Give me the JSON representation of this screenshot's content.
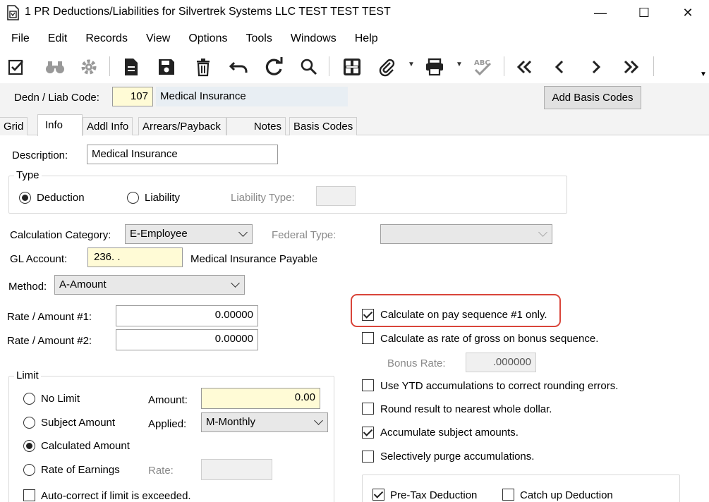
{
  "window": {
    "title": "1 PR Deductions/Liabilities for Silvertrek Systems LLC TEST TEST TEST",
    "icon": "app-document-icon",
    "controls": {
      "minimize": "—",
      "maximize": "☐",
      "close": "✕"
    }
  },
  "menu": [
    "File",
    "Edit",
    "Records",
    "View",
    "Options",
    "Tools",
    "Windows",
    "Help"
  ],
  "toolbar": {
    "icons": [
      "edit-check-icon",
      "binoculars-icon",
      "gear-icon",
      "new-document-icon",
      "save-icon",
      "trash-icon",
      "undo-icon",
      "refresh-icon",
      "search-icon",
      "grid-icon",
      "paperclip-icon",
      "print-icon",
      "spellcheck-icon",
      "first-record-icon",
      "previous-record-icon",
      "next-record-icon",
      "last-record-icon"
    ]
  },
  "header": {
    "code_label": "Dedn / Liab Code:",
    "code_value": "107",
    "code_description": "Medical Insurance",
    "add_basis_button": "Add Basis Codes"
  },
  "tabs": [
    {
      "label": "Grid",
      "active": false
    },
    {
      "label": "Info",
      "active": true
    },
    {
      "label": "Addl Info",
      "active": false
    },
    {
      "label": "Arrears/Payback",
      "active": false
    },
    {
      "label": "Notes",
      "active": false
    },
    {
      "label": "Basis Codes",
      "active": false
    }
  ],
  "info": {
    "description_label": "Description:",
    "description_value": "Medical Insurance",
    "type": {
      "title": "Type",
      "deduction": "Deduction",
      "liability": "Liability",
      "selected": "Deduction",
      "liability_type_label": "Liability Type:",
      "liability_type_value": ""
    },
    "calc_category_label": "Calculation Category:",
    "calc_category_value": "E-Employee",
    "federal_type_label": "Federal Type:",
    "federal_type_value": "",
    "gl_account_label": "GL Account:",
    "gl_account_value": "236.  .",
    "gl_account_description": "Medical Insurance Payable",
    "method_label": "Method:",
    "method_value": "A-Amount",
    "rate1_label": "Rate / Amount #1:",
    "rate1_value": "0.00000",
    "rate2_label": "Rate / Amount #2:",
    "rate2_value": "0.00000",
    "limit": {
      "title": "Limit",
      "no_limit": "No Limit",
      "subject_amount": "Subject Amount",
      "calculated_amount": "Calculated Amount",
      "rate_of_earnings": "Rate of Earnings",
      "selected": "Calculated Amount",
      "amount_label": "Amount:",
      "amount_value": "0.00",
      "applied_label": "Applied:",
      "applied_value": "M-Monthly",
      "rate_label": "Rate:",
      "rate_value": "",
      "auto_correct": "Auto-correct if limit is exceeded.",
      "auto_correct_checked": false
    },
    "options": {
      "pay_seq1_only": {
        "label": "Calculate on pay sequence #1 only.",
        "checked": true
      },
      "rate_of_gross_bonus": {
        "label": "Calculate as rate of gross on bonus sequence.",
        "checked": false
      },
      "bonus_rate_label": "Bonus Rate:",
      "bonus_rate_value": ".000000",
      "ytd_rounding": {
        "label": "Use YTD accumulations to correct rounding errors.",
        "checked": false
      },
      "round_whole_dollar": {
        "label": "Round result to nearest whole dollar.",
        "checked": false
      },
      "accumulate_subject": {
        "label": "Accumulate subject amounts.",
        "checked": true
      },
      "selective_purge": {
        "label": "Selectively purge accumulations.",
        "checked": false
      },
      "pre_tax": {
        "label": "Pre-Tax Deduction",
        "checked": true
      },
      "catch_up": {
        "label": "Catch up Deduction",
        "checked": false
      }
    }
  },
  "colors": {
    "highlight": "#d9453a",
    "required_field": "#fffbd6",
    "tab_strip": "#f3f3f3"
  }
}
